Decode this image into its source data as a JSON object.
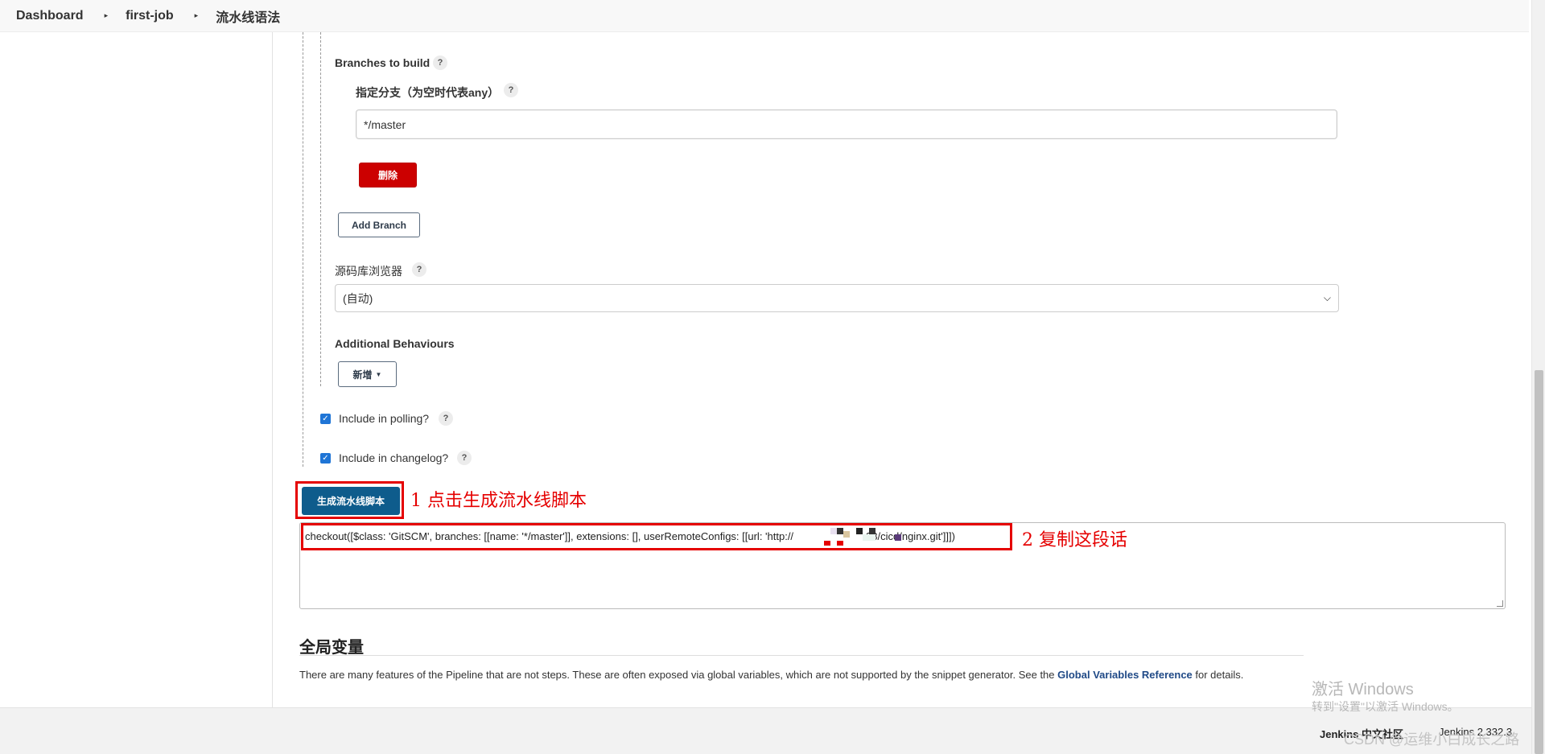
{
  "breadcrumb": {
    "items": [
      "Dashboard",
      "first-job",
      "流水线语法"
    ],
    "separator": "▸"
  },
  "branches": {
    "section_label": "Branches to build",
    "spec_label": "指定分支（为空时代表any）",
    "spec_value": "*/master",
    "delete_label": "删除",
    "add_branch_label": "Add Branch"
  },
  "browser": {
    "label": "源码库浏览器",
    "selected": "(自动)"
  },
  "behaviours": {
    "label": "Additional Behaviours",
    "add_label": "新增"
  },
  "options": {
    "polling_label": "Include in polling?",
    "polling_checked": true,
    "changelog_label": "Include in changelog?",
    "changelog_checked": true
  },
  "help_glyph": "?",
  "generate": {
    "button_label": "生成流水线脚本",
    "annotation": "1   点击生成流水线脚本"
  },
  "snippet": {
    "text_before": "checkout([$class: 'GitSCM', branches: [[name: '*/master']], extensions: [], userRemoteConfigs: [[url: 'http://",
    "text_after": "38/cicd/nginx.git']]])",
    "annotation": "2   复制这段话"
  },
  "global_vars": {
    "heading": "全局变量",
    "desc_before": "There are many features of the Pipeline that are not steps. These are often exposed via global variables, which are not supported by the snippet generator. See the ",
    "link_text": "Global Variables Reference",
    "desc_after": " for details."
  },
  "footer": {
    "community": "Jenkins 中文社区",
    "version": "Jenkins 2.332.3"
  },
  "watermark": {
    "line1": "激活 Windows",
    "line2": "转到\"设置\"以激活 Windows。",
    "csdn": "CSDN @运维小白成长之路"
  },
  "colors": {
    "accent_blue": "#0e5c8c",
    "delete_red": "#cc0000",
    "annotation_red": "#e50000",
    "link_blue": "#204a87"
  }
}
